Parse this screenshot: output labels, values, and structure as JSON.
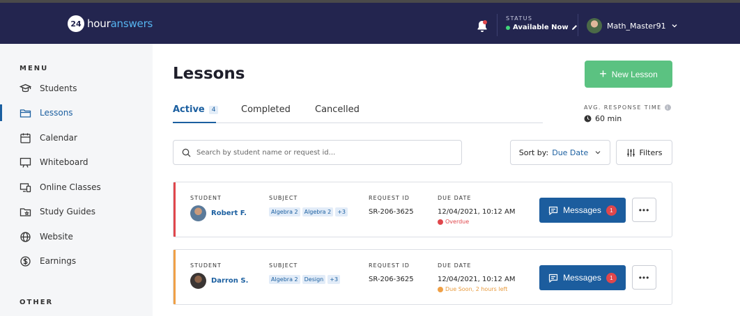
{
  "header": {
    "logo_badge": "24",
    "logo_word1": "hour",
    "logo_word2": "answers",
    "status_label": "STATUS",
    "status_value": "Available Now",
    "username": "Math_Master91",
    "icons": [
      "bell-icon",
      "pencil-icon",
      "chevron-down-icon"
    ],
    "colors": {
      "bar": "#23254f",
      "status_dot": "#3fd67a",
      "notification_dot": "#e0474c"
    }
  },
  "sidebar": {
    "menu_label": "MENU",
    "items": [
      {
        "label": "Students",
        "icon": "graduation-cap-icon"
      },
      {
        "label": "Lessons",
        "icon": "folder-icon",
        "active": true
      },
      {
        "label": "Calendar",
        "icon": "calendar-icon"
      },
      {
        "label": "Whiteboard",
        "icon": "whiteboard-icon"
      },
      {
        "label": "Online Classes",
        "icon": "devices-icon"
      },
      {
        "label": "Study Guides",
        "icon": "folder-star-icon"
      },
      {
        "label": "Website",
        "icon": "globe-icon"
      },
      {
        "label": "Earnings",
        "icon": "dollar-circle-icon"
      }
    ],
    "other_label": "OTHER"
  },
  "main": {
    "title": "Lessons",
    "new_lesson_label": "New Lesson",
    "tabs": [
      {
        "label": "Active",
        "count": "4",
        "active": true
      },
      {
        "label": "Completed"
      },
      {
        "label": "Cancelled"
      }
    ],
    "avg_response_label": "AVG. RESPONSE TIME",
    "avg_response_value": "60 min",
    "search_placeholder": "Search by student name or request id...",
    "sort_label": "Sort by:",
    "sort_value": "Due Date",
    "filters_label": "Filters",
    "columns": {
      "student": "STUDENT",
      "subject": "SUBJECT",
      "request_id": "REQUEST ID",
      "due_date": "DUE DATE"
    },
    "lessons": [
      {
        "student": "Robert F.",
        "tags": [
          "Algebra 2",
          "Algebra 2",
          "+3"
        ],
        "request_id": "SR-206-3625",
        "due_date": "12/04/2021, 10:12 AM",
        "due_note": "Overdue",
        "accent_color": "#e0474c",
        "messages_label": "Messages",
        "message_count": "1"
      },
      {
        "student": "Darron S.",
        "tags": [
          "Algebra 2",
          "Design",
          "+3"
        ],
        "request_id": "SR-206-3625",
        "due_date": "12/04/2021, 10:12 AM",
        "due_note": "Due Soon, 2 hours left",
        "accent_color": "#f0a046",
        "messages_label": "Messages",
        "message_count": "1"
      }
    ]
  }
}
